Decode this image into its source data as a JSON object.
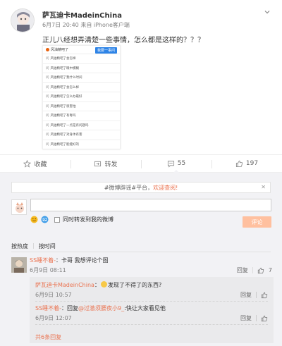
{
  "post": {
    "author": "萨瓦迪卡MadeinChina",
    "time": "6月7日 20:40",
    "source_prefix": "来自",
    "source": "iPhone客户端",
    "text": "正儿八经想弄清楚一些事情，怎么都是这样的？？？",
    "screenshot": {
      "header": "风油精吧了",
      "ask_button": "我要一事问",
      "rows": [
        "风油精吧了会怎样",
        "风油精吧了眼中模糊",
        "风油精吧了我什么时间",
        "风油精吧了会怎么样",
        "风油精吧了怎么办最好",
        "风油精吧了很害怕",
        "风油精吧了有毒吗",
        "风油精吧了一点是有问题吗",
        "风油精吧了对身体有害",
        "风油精吧了能能好的"
      ]
    }
  },
  "actions": {
    "favorite": "收藏",
    "repost": "转发",
    "comment_count": "55",
    "like_count": "197"
  },
  "comment_box": {
    "notice_prefix": "#微博辟谣#平台，",
    "notice_link": "欢迎查阅!",
    "repost_label": "同时转发到我的微博",
    "submit": "评论"
  },
  "sort": {
    "by_heat": "按热度",
    "by_time": "按时间"
  },
  "comments": [
    {
      "author": "SS睡不着-",
      "text": "：卡哥 我想评论个图",
      "time": "6月9日 08:11",
      "reply_label": "回复",
      "likes": "7"
    }
  ],
  "replies": [
    {
      "author": "萨瓦迪卡MadeinChina",
      "text_after_emoji": "发现了不得了的东西?",
      "time": "6月9日 10:57",
      "reply_label": "回复"
    },
    {
      "author": "SS睡不着-",
      "text_prefix": "：回复",
      "mention": "@过激须腰夜小9_",
      "text_suffix": ":快让大家看见他",
      "time": "6月9日 12:07",
      "reply_label": "回复"
    }
  ],
  "more_replies": "共6条回复",
  "colors": {
    "accent": "#eb7350",
    "submit_disabled": "#ffc09f",
    "comment_bg": "#f2f2f5"
  }
}
